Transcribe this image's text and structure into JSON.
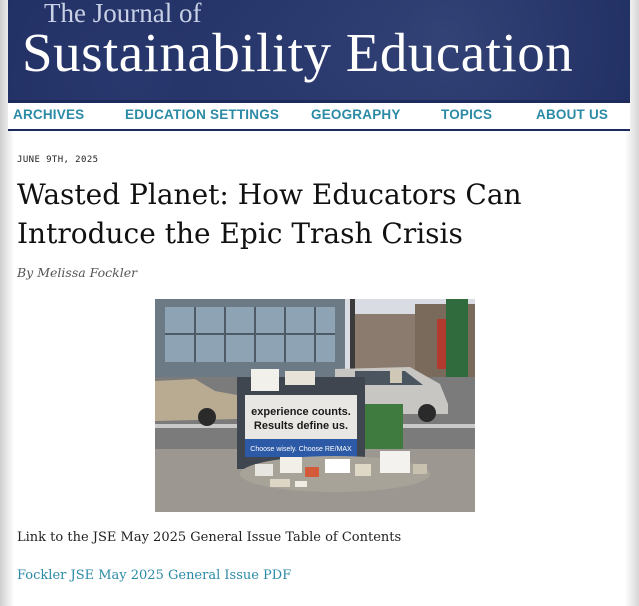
{
  "masthead": {
    "line1": "The Journal of",
    "line2": "Sustainability Education"
  },
  "nav": {
    "items": [
      {
        "label": "ARCHIVES"
      },
      {
        "label": "EDUCATION SETTINGS"
      },
      {
        "label": "GEOGRAPHY"
      },
      {
        "label": "TOPICS"
      },
      {
        "label": "ABOUT US"
      }
    ],
    "color": "#2b8aa6"
  },
  "article": {
    "date": "JUNE 9TH, 2025",
    "title": "Wasted Planet: How Educators Can Introduce the Epic Trash Crisis",
    "byline": "By Melissa Fockler",
    "photo": {
      "sign_line1": "experience counts.",
      "sign_line2": "Results define us.",
      "sign_line3": "Choose wisely. Choose RE/MAX"
    },
    "toc_text": "Link to the JSE May 2025 General Issue Table of Contents",
    "pdf_link": "Fockler JSE May 2025 General Issue PDF"
  },
  "colors": {
    "masthead_bg": "#1c2a5e",
    "link": "#2b8aa6"
  }
}
